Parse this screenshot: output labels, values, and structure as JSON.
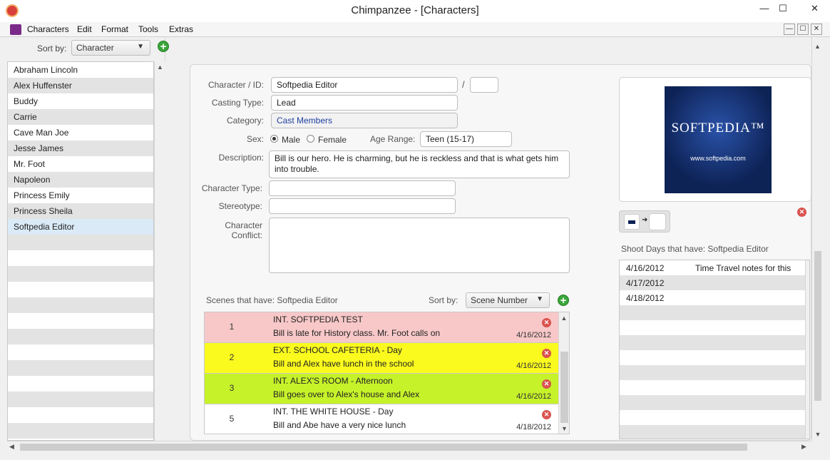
{
  "window": {
    "title": "Chimpanzee - [Characters]",
    "minimize_glyph": "—",
    "maximize_glyph": "☐",
    "close_glyph": "✕"
  },
  "menu": [
    "Characters",
    "Edit",
    "Format",
    "Tools",
    "Extras"
  ],
  "left": {
    "sort_label": "Sort by:",
    "sort_value": "Character",
    "add_glyph": "+",
    "characters": [
      "Abraham Lincoln",
      "Alex Huffenster",
      "Buddy",
      "Carrie",
      "Cave Man Joe",
      "Jesse James",
      "Mr. Foot",
      "Napoleon",
      "Princess Emily",
      "Princess Sheila",
      "Softpedia Editor"
    ]
  },
  "form": {
    "character_id_label": "Character / ID:",
    "character_value": "Softpedia Editor",
    "id_separator": "/",
    "id_value": "",
    "casting_type_label": "Casting Type:",
    "casting_type_value": "Lead",
    "category_label": "Category:",
    "category_value": "Cast Members",
    "sex_label": "Sex:",
    "sex_male": "Male",
    "sex_female": "Female",
    "sex_selected": "Male",
    "age_range_label": "Age Range:",
    "age_range_value": "Teen (15-17)",
    "description_label": "Description:",
    "description_value": "Bill is our hero. He is charming, but he is reckless and that is what gets him into trouble.",
    "character_type_label": "Character Type:",
    "character_type_value": "",
    "stereotype_label": "Stereotype:",
    "stereotype_value": "",
    "conflict_label_1": "Character",
    "conflict_label_2": "Conflict:",
    "conflict_value": ""
  },
  "scenes": {
    "title": "Scenes that have: Softpedia Editor",
    "sort_label": "Sort by:",
    "sort_value": "Scene Number",
    "items": [
      {
        "num": "1",
        "heading": "INT. SOFTPEDIA TEST",
        "desc": "Bill is late for History class. Mr. Foot calls on",
        "date": "4/16/2012",
        "color": "#f8c8c8"
      },
      {
        "num": "2",
        "heading": "EXT. SCHOOL CAFETERIA - Day",
        "desc": "Bill and Alex have lunch in the school",
        "date": "4/16/2012",
        "color": "#fafa1e"
      },
      {
        "num": "3",
        "heading": "INT. ALEX'S ROOM - Afternoon",
        "desc": "Bill goes over to Alex's house and Alex",
        "date": "4/16/2012",
        "color": "#c6f22a"
      },
      {
        "num": "5",
        "heading": "INT. THE WHITE HOUSE - Day",
        "desc": "Bill and Abe have a very nice lunch",
        "date": "4/18/2012",
        "color": "#ffffff"
      }
    ]
  },
  "photo": {
    "brand": "SOFTPEDIA™",
    "url": "www.softpedia.com"
  },
  "shoot_days": {
    "title": "Shoot Days that have: Softpedia Editor",
    "rows": [
      {
        "date": "4/16/2012",
        "note": "Time Travel notes for this"
      },
      {
        "date": "4/17/2012",
        "note": ""
      },
      {
        "date": "4/18/2012",
        "note": ""
      }
    ]
  },
  "colors": {
    "accent_add": "#3aa63a",
    "delete": "#d9534f",
    "selected_row": "#dbeaf7"
  }
}
